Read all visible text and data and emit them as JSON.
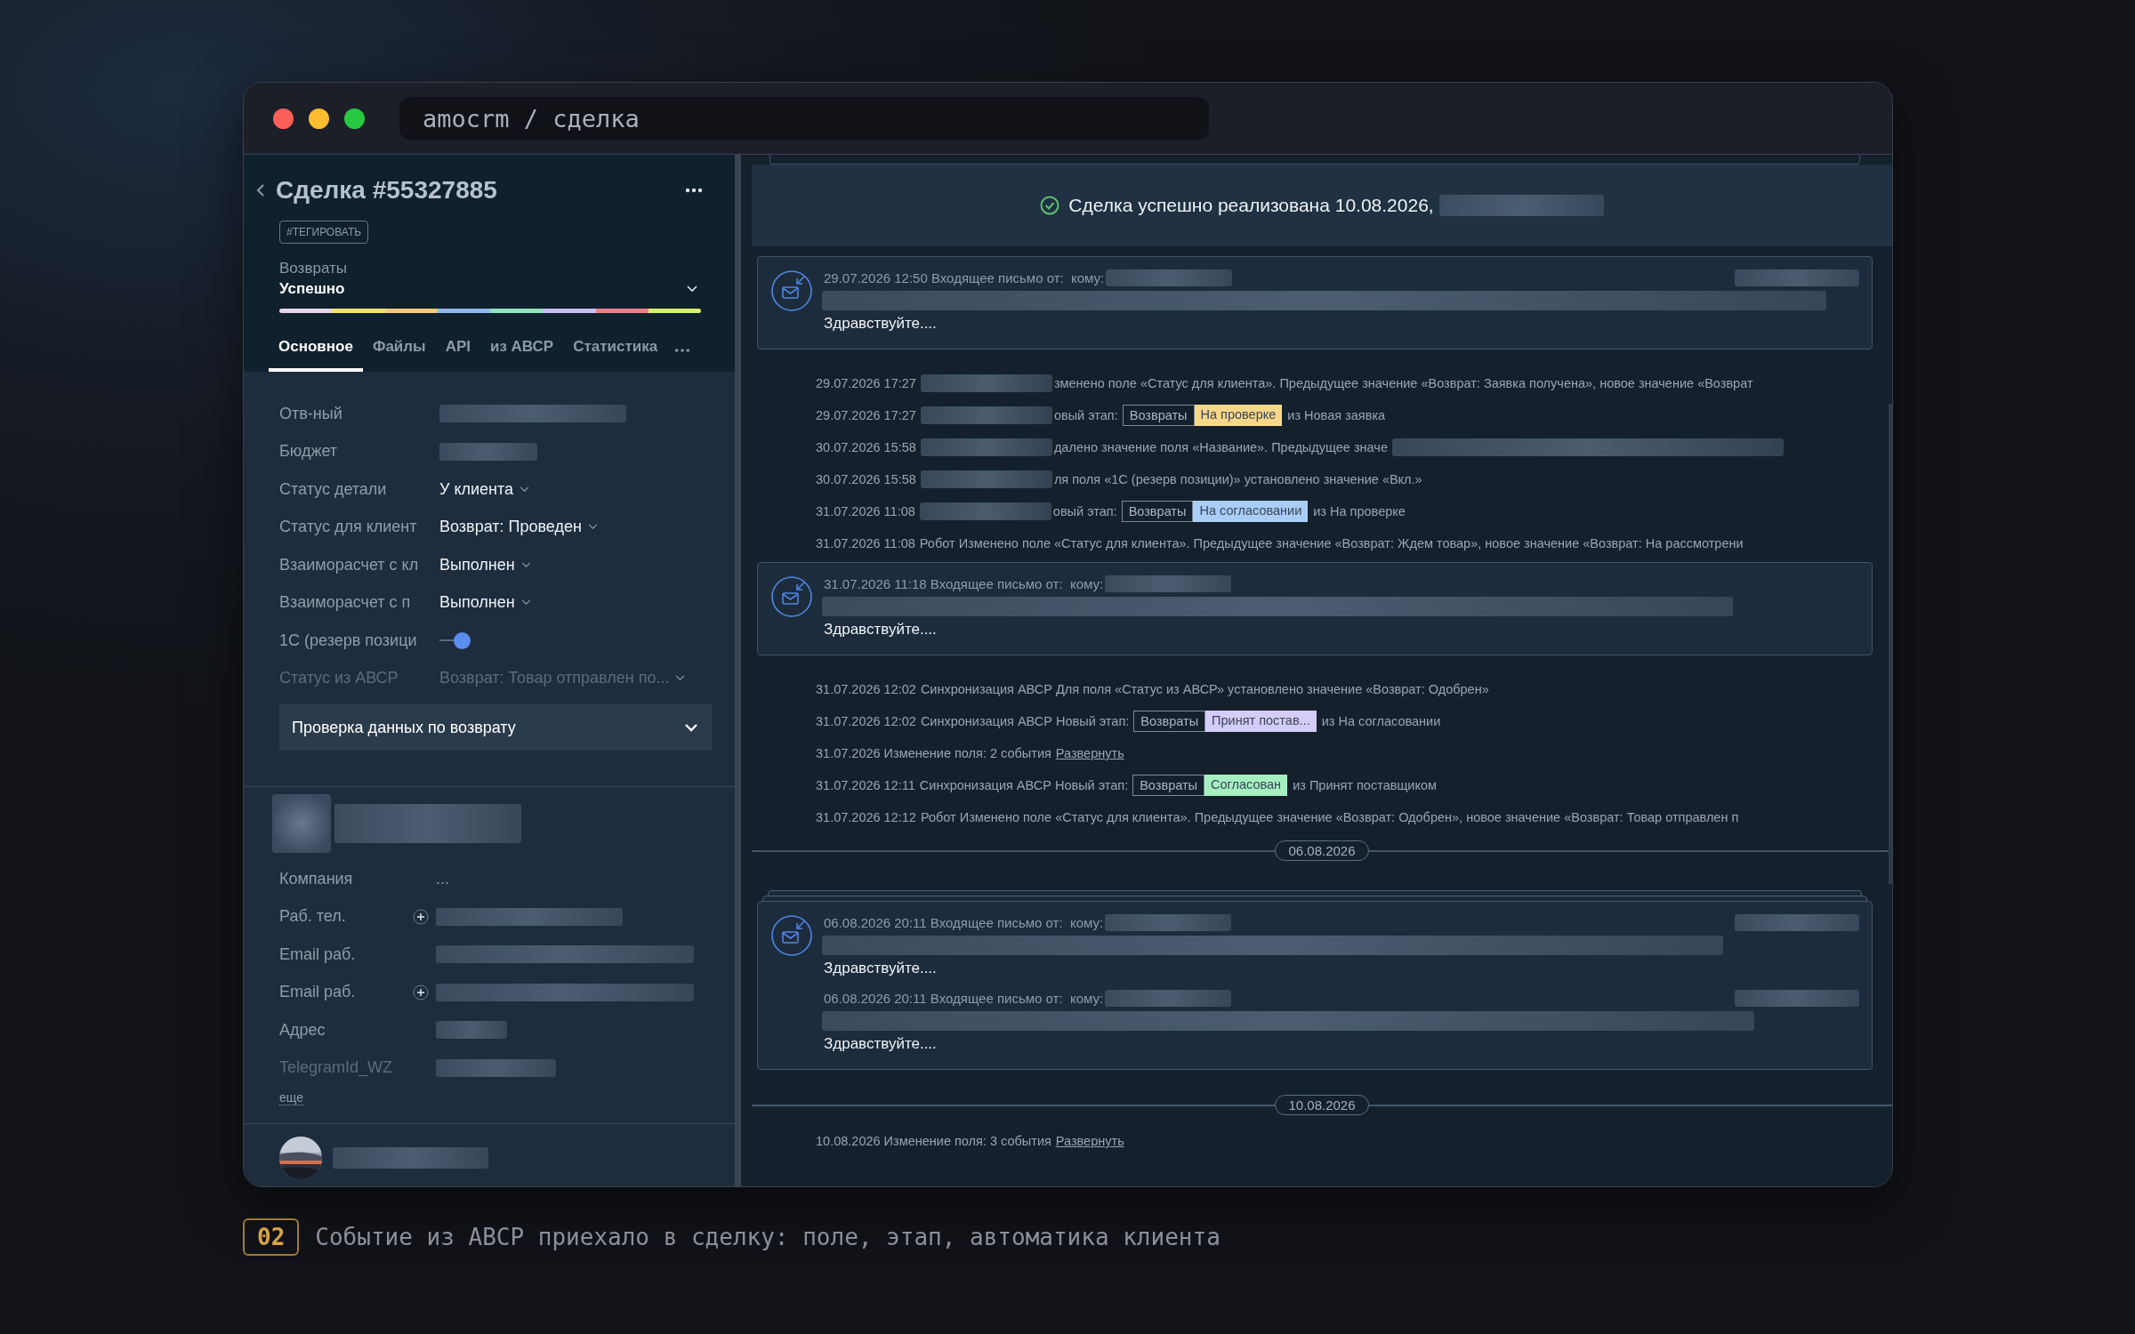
{
  "window": {
    "title": "amocrm / сделка"
  },
  "deal": {
    "title": "Сделка #55327885",
    "tag": "#ТЕГИРОВАТЬ",
    "pipeline": "Возвраты",
    "status": "Успешно",
    "tabs": [
      {
        "label": "Основное",
        "selected": true
      },
      {
        "label": "Файлы",
        "selected": false
      },
      {
        "label": "API",
        "selected": false
      },
      {
        "label": "из АВСР",
        "selected": false
      },
      {
        "label": "Статистика",
        "selected": false
      }
    ],
    "fields": [
      {
        "label": "Отв-ный",
        "kind": "hidden",
        "muted": false
      },
      {
        "label": "Бюджет",
        "kind": "hidden",
        "muted": false
      },
      {
        "label": "Статус детали",
        "kind": "select",
        "value": "У клиента",
        "muted": false
      },
      {
        "label": "Статус для клиент",
        "kind": "select",
        "value": "Возврат: Проведен",
        "muted": false
      },
      {
        "label": "Взаиморасчет с кл",
        "kind": "select",
        "value": "Выполнен",
        "muted": false
      },
      {
        "label": "Взаиморасчет с п",
        "kind": "select",
        "value": "Выполнен",
        "muted": false
      },
      {
        "label": "1С (резерв позици",
        "kind": "toggle",
        "on": true,
        "muted": false
      },
      {
        "label": "Статус из АВСР",
        "kind": "select",
        "value": "Возврат: Товар отправлен по...",
        "muted": true
      }
    ],
    "section": "Проверка данных по возврату"
  },
  "contact": {
    "fields": [
      {
        "label": "Компания",
        "kind": "text",
        "value": "...",
        "add": false,
        "muted": false
      },
      {
        "label": "Раб. тел.",
        "kind": "hidden",
        "add": true,
        "muted": false
      },
      {
        "label": "Email раб.",
        "kind": "hidden",
        "add": false,
        "muted": false
      },
      {
        "label": "Email раб.",
        "kind": "hidden",
        "add": true,
        "muted": false
      },
      {
        "label": "Адрес",
        "kind": "hidden",
        "add": false,
        "muted": false
      },
      {
        "label": "TelegramId_WZ",
        "kind": "hidden",
        "add": false,
        "muted": true
      }
    ],
    "more_link": "еще"
  },
  "feed": {
    "banner": "Сделка успешно реализована 10.08.2026,",
    "items": [
      {
        "kind": "mail",
        "stacked": false,
        "messages": [
          {
            "header": "29.07.2026 12:50 Входящее письмо от:  кому:",
            "sender_hidden": true,
            "greeting": "Здравствуйте...."
          }
        ]
      },
      {
        "kind": "event",
        "time": "29.07.2026 17:27",
        "author_hidden": true,
        "text": "зменено поле «Статус для клиента». Предыдущее значение «Возврат: Заявка получена», новое значение «Возврат",
        "tail_hidden": false
      },
      {
        "kind": "stage",
        "time": "29.07.2026 17:27",
        "author_hidden": true,
        "prefix": "овый этап:",
        "pipeline": "Возвраты",
        "stage": "На проверке",
        "color": "#f8d68a",
        "from": "из Новая заявка"
      },
      {
        "kind": "event",
        "time": "30.07.2026 15:58",
        "author_hidden": true,
        "text": "далено значение поля «Название». Предыдущее значе",
        "tail_hidden": true
      },
      {
        "kind": "event",
        "time": "30.07.2026 15:58",
        "author_hidden": true,
        "text": "ля поля «1С (резерв позиции)» установлено значение «Вкл.»",
        "tail_hidden": false
      },
      {
        "kind": "stage",
        "time": "31.07.2026 11:08",
        "author_hidden": true,
        "prefix": "овый этап:",
        "pipeline": "Возвраты",
        "stage": "На согласовании",
        "color": "#a9cdf7",
        "from": "из На проверке"
      },
      {
        "kind": "event",
        "time": "31.07.2026 11:08",
        "author_hidden": false,
        "text": "Робот Изменено поле «Статус для клиента». Предыдущее значение «Возврат: Ждем товар», новое значение «Возврат: На рассмотрени",
        "tail_hidden": false
      },
      {
        "kind": "mail",
        "stacked": false,
        "messages": [
          {
            "header": "31.07.2026 11:18 Входящее письмо от:  кому:",
            "sender_hidden": false,
            "greeting": "Здравствуйте...."
          }
        ]
      },
      {
        "kind": "event",
        "time": "31.07.2026 12:02",
        "author_hidden": false,
        "text": "Синхронизация АВСР Для поля «Статус из АВСР» установлено значение «Возврат: Одобрен»",
        "tail_hidden": false
      },
      {
        "kind": "stage",
        "time": "31.07.2026 12:02",
        "author_hidden": false,
        "prefix": "Синхронизация АВСР Новый этап:",
        "pipeline": "Возвраты",
        "stage": "Принят постав...",
        "color": "#d5cdf9",
        "from": "из На согласовании"
      },
      {
        "kind": "collapsed",
        "text": "31.07.2026 Изменение поля: 2 события",
        "link": "Развернуть"
      },
      {
        "kind": "stage",
        "time": "31.07.2026 12:11",
        "author_hidden": false,
        "prefix": "Синхронизация АВСР Новый этап:",
        "pipeline": "Возвраты",
        "stage": "Согласован",
        "color": "#a6efc1",
        "from": "из Принят поставщиком"
      },
      {
        "kind": "event",
        "time": "31.07.2026 12:12",
        "author_hidden": false,
        "text": "Робот Изменено поле «Статус для клиента». Предыдущее значение «Возврат: Одобрен», новое значение «Возврат: Товар отправлен п",
        "tail_hidden": false
      },
      {
        "kind": "date",
        "text": "06.08.2026"
      },
      {
        "kind": "mail",
        "stacked": true,
        "messages": [
          {
            "header": "06.08.2026 20:11 Входящее письмо от:  кому:",
            "sender_hidden": true,
            "greeting": "Здравствуйте...."
          },
          {
            "header": "06.08.2026 20:11 Входящее письмо от:  кому:",
            "sender_hidden": true,
            "greeting": "Здравствуйте...."
          }
        ]
      },
      {
        "kind": "date",
        "text": "10.08.2026"
      },
      {
        "kind": "collapsed",
        "text": "10.08.2026 Изменение поля: 3 события",
        "link": "Развернуть"
      }
    ]
  },
  "caption": {
    "badge": "02",
    "text": "Событие из АВСР приехало в сделку: поле, этап, автоматика клиента"
  }
}
